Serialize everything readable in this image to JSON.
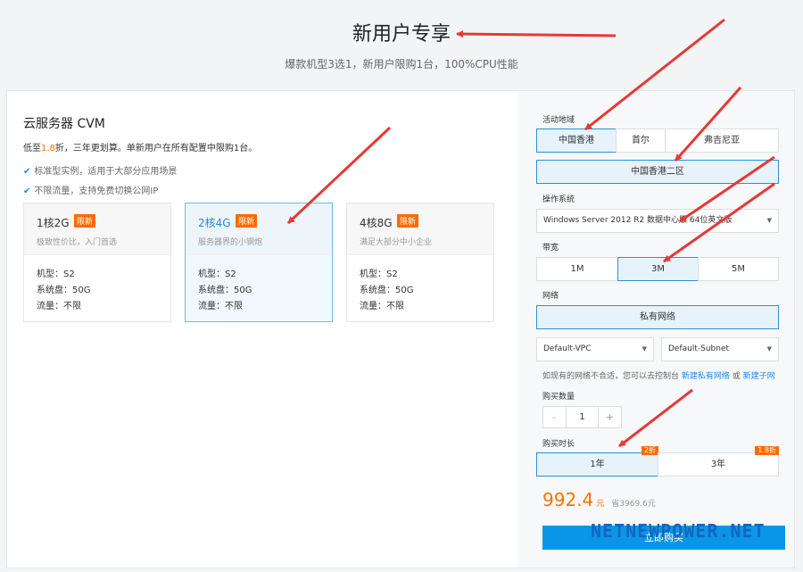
{
  "hero": {
    "title": "新用户专享",
    "subtitle": "爆款机型3选1，新用户限购1台，100%CPU性能"
  },
  "product": {
    "title": "云服务器 CVM",
    "desc_prefix": "低至",
    "desc_highlight": "1.8",
    "desc_suffix": "折，三年更划算。单新用户在所有配置中限购1台。",
    "features": [
      "标准型实例，适用于大部分应用场景",
      "不限流量，支持免费切换公网IP"
    ]
  },
  "specs": [
    {
      "name": "1核2G",
      "tag": "限新",
      "sub": "极致性价比，入门首选",
      "model": "机型：S2",
      "disk": "系统盘：50G",
      "traffic": "流量：不限"
    },
    {
      "name": "2核4G",
      "tag": "限新",
      "sub": "服务器界的小钢炮",
      "model": "机型：S2",
      "disk": "系统盘：50G",
      "traffic": "流量：不限"
    },
    {
      "name": "4核8G",
      "tag": "限新",
      "sub": "满足大部分中小企业",
      "model": "机型：S2",
      "disk": "系统盘：50G",
      "traffic": "流量：不限"
    }
  ],
  "config": {
    "region_label": "活动地域",
    "regions": [
      "中国香港",
      "首尔",
      "弗吉尼亚"
    ],
    "zone": "中国香港二区",
    "os_label": "操作系统",
    "os_value": "Windows Server 2012 R2 数据中心版 64位英文版",
    "bandwidth_label": "带宽",
    "bandwidths": [
      "1M",
      "3M",
      "5M"
    ],
    "network_label": "网络",
    "network_value": "私有网络",
    "vpc": "Default-VPC",
    "subnet": "Default-Subnet",
    "note_text": "如现有的网络不合适，您可以去控制台 ",
    "note_link1": "新建私有网络",
    "note_or": " 或 ",
    "note_link2": "新建子网",
    "qty_label": "购买数量",
    "qty_minus": "–",
    "qty_value": "1",
    "qty_plus": "+",
    "duration_label": "购买时长",
    "durations": [
      {
        "label": "1年",
        "discount": "2折"
      },
      {
        "label": "3年",
        "discount": "1.8折"
      }
    ],
    "price": "992.4",
    "currency": "元",
    "saving": "省3969.6元",
    "buy_label": "立即购买"
  },
  "watermark": "NETNEWPOWER.NET",
  "colors": {
    "accent": "#1e88e5",
    "price": "#ff7200",
    "tag": "#ff6a00",
    "arrow": "#e53935"
  }
}
